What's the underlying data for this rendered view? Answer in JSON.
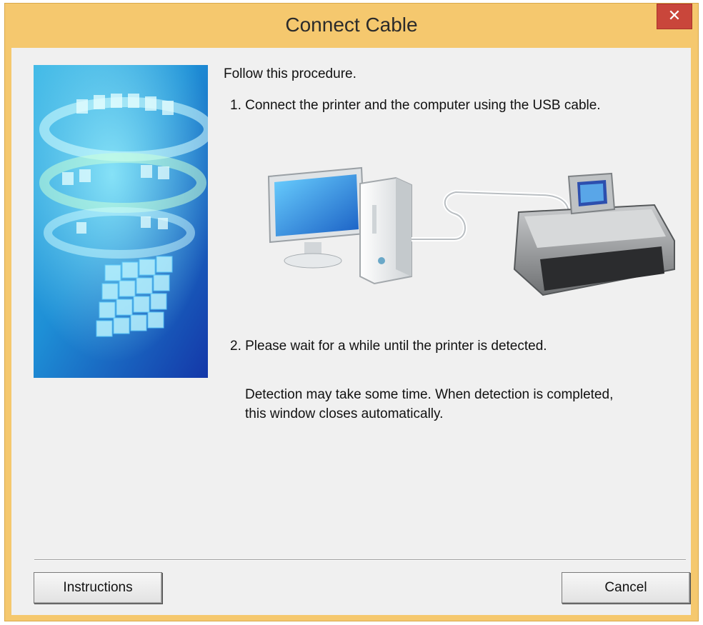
{
  "window": {
    "title": "Connect Cable",
    "close_label": "✕"
  },
  "content": {
    "intro": "Follow this procedure.",
    "step1": "1.   Connect the printer and the computer using the USB cable.",
    "step2": "2.   Please wait for a while until the printer is detected.",
    "note_line1": "Detection may take some time. When detection is completed,",
    "note_line2": "this window closes automatically."
  },
  "buttons": {
    "instructions": "Instructions",
    "cancel": "Cancel"
  },
  "colors": {
    "title_bar": "#f5c86e",
    "close_button": "#c9463b",
    "dialog_bg": "#f0f0f0"
  },
  "icons": [
    "close-icon",
    "canon-banner-image",
    "computer-printer-usb-illustration"
  ]
}
